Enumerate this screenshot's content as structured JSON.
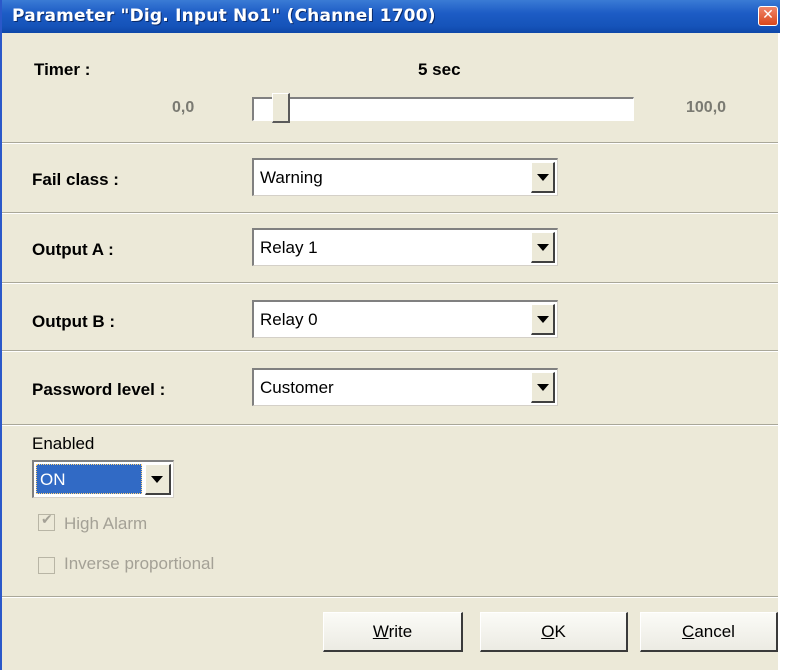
{
  "window": {
    "title": "Parameter \"Dig. Input No1\" (Channel 1700)",
    "close_glyph": "✕"
  },
  "timer": {
    "label": "Timer :",
    "value_text": "5 sec",
    "min_label": "0,0",
    "max_label": "100,0",
    "value": 5,
    "min": 0,
    "max": 100
  },
  "fail_class": {
    "label": "Fail class :",
    "value": "Warning"
  },
  "output_a": {
    "label": "Output A :",
    "value": "Relay 1"
  },
  "output_b": {
    "label": "Output B :",
    "value": "Relay 0"
  },
  "password_level": {
    "label": "Password level :",
    "value": "Customer"
  },
  "enabled": {
    "label": "Enabled",
    "value": "ON"
  },
  "high_alarm": {
    "label": "High Alarm",
    "checked": true,
    "disabled": true
  },
  "inverse_proportional": {
    "label": "Inverse proportional",
    "checked": false,
    "disabled": true
  },
  "buttons": {
    "write_mnemonic": "W",
    "write_rest": "rite",
    "ok_mnemonic": "O",
    "ok_rest": "K",
    "cancel_mnemonic": "C",
    "cancel_rest": "ancel"
  },
  "colors": {
    "title_bar": "#1d5cc5",
    "dialog_bg": "#ece9d8",
    "selection": "#316ac5",
    "close_button": "#d9471c"
  },
  "icons": {
    "close": "close-icon",
    "dropdown": "chevron-down-icon",
    "checkbox": "checkmark-icon"
  }
}
